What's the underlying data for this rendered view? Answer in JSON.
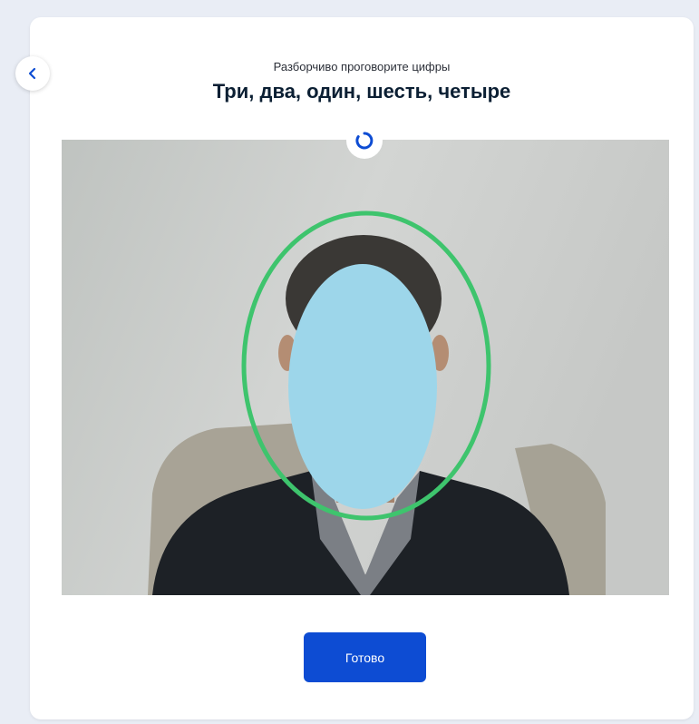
{
  "header": {
    "subtitle": "Разборчиво проговорите цифры",
    "title": "Три, два, один, шесть, четыре"
  },
  "actions": {
    "done_label": "Готово"
  },
  "icons": {
    "back": "chevron-left-icon",
    "loading": "loading-spinner-icon"
  },
  "colors": {
    "primary_button": "#0d4cd3",
    "face_guide": "#3ec46d",
    "face_mask": "#9dd6ea",
    "back_icon": "#0d4cd3"
  }
}
